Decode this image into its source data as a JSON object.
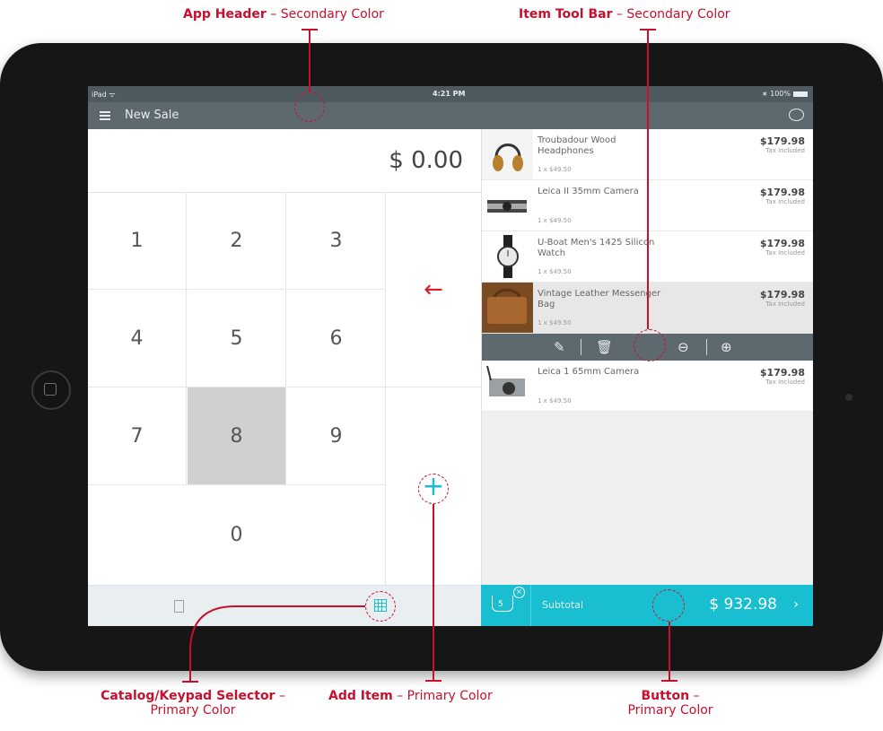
{
  "callouts": {
    "app_header": {
      "title": "App Header",
      "desc": " – Secondary Color"
    },
    "item_toolbar": {
      "title": "Item Tool Bar",
      "desc": " – Secondary Color"
    },
    "catalog_selector": {
      "title": "Catalog/Keypad Selector",
      "desc1": " –",
      "desc2": "Primary Color"
    },
    "add_item": {
      "title": "Add Item",
      "desc": " – Primary Color"
    },
    "button": {
      "title": "Button",
      "desc1": " –",
      "desc2": "Primary Color"
    }
  },
  "status_bar": {
    "device": "iPad",
    "time": "4:21 PM",
    "battery": "100%"
  },
  "header": {
    "title": "New Sale"
  },
  "keypad": {
    "amount": "$ 0.00",
    "keys": [
      "1",
      "2",
      "3",
      "4",
      "5",
      "6",
      "7",
      "8",
      "9",
      "0"
    ],
    "active_key": "8",
    "backspace": "←",
    "add": "+"
  },
  "cart": {
    "items": [
      {
        "name": "Troubadour Wood Headphones",
        "qty": "1 x $49.50",
        "price": "$179.98",
        "tax": "Tax Included"
      },
      {
        "name": "Leica II 35mm Camera",
        "qty": "1 x $49.50",
        "price": "$179.98",
        "tax": "Tax Included"
      },
      {
        "name": "U-Boat Men's 1425 Silicon Watch",
        "qty": "1 x $49.50",
        "price": "$179.98",
        "tax": "Tax Included"
      },
      {
        "name": "Vintage Leather Messenger Bag",
        "qty": "1 x $49.50",
        "price": "$179.98",
        "tax": "Tax Included"
      },
      {
        "name": "Leica 1 65mm Camera",
        "qty": "1 x $49.50",
        "price": "$179.98",
        "tax": "Tax Included"
      }
    ],
    "selected_index": 3
  },
  "checkout": {
    "cart_count": "5",
    "subtotal_label": "Subtotal",
    "total": "$ 932.98",
    "chevron": "›"
  },
  "colors": {
    "primary": "#19bfd0",
    "secondary": "#5d696f",
    "annotation": "#c8102e"
  }
}
